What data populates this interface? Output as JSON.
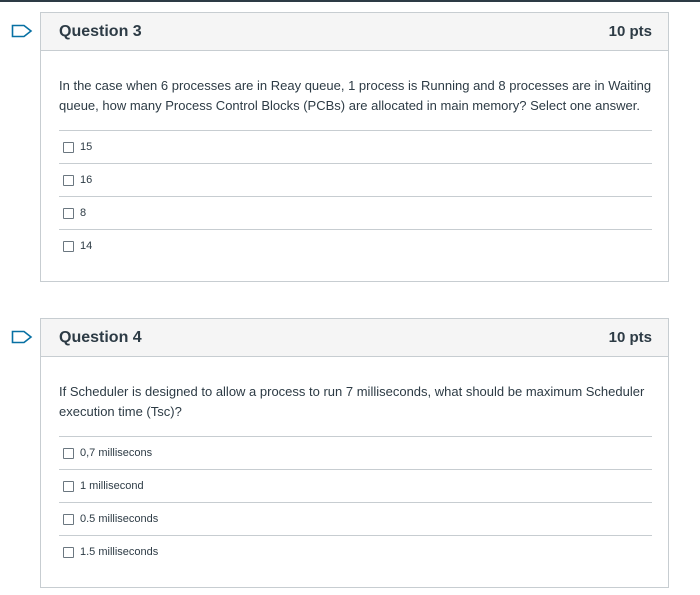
{
  "questions": [
    {
      "title": "Question 3",
      "points": "10 pts",
      "text": "In the case when 6 processes are in Reay queue, 1 process is Running and 8 processes are in Waiting queue, how many Process Control Blocks (PCBs) are allocated in main memory? Select one answer.",
      "answers": [
        "15",
        "16",
        "8",
        "14"
      ]
    },
    {
      "title": "Question 4",
      "points": "10 pts",
      "text": "If Scheduler is designed to allow a process to run 7 milliseconds, what should be maximum Scheduler execution time (Tsc)?",
      "answers": [
        "0,7 millisecons",
        "1 millisecond",
        "0.5 milliseconds",
        "1.5 milliseconds"
      ]
    }
  ],
  "colors": {
    "flag": "#0770a3",
    "border": "#c7cdd1",
    "header_bg": "#f5f5f5",
    "text": "#2d3b45"
  },
  "icons": {
    "flag": "bookmark-flag-icon",
    "checkbox": "checkbox-icon"
  }
}
